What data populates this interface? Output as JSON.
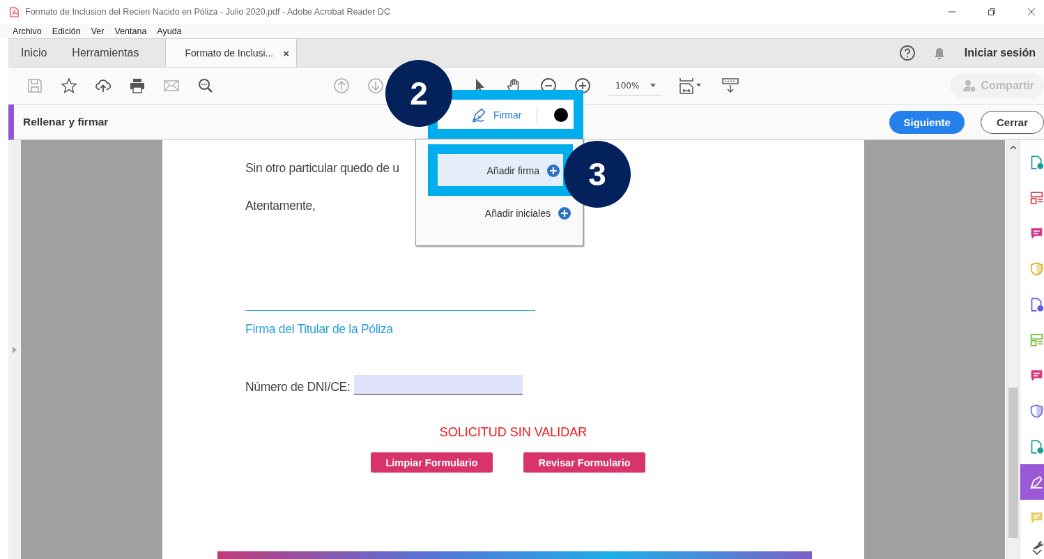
{
  "window": {
    "title": "Formato de Inclusion del Recien Nacido en Póliza - Julio 2020.pdf - Adobe Acrobat Reader DC"
  },
  "menu": [
    "Archivo",
    "Edición",
    "Ver",
    "Ventana",
    "Ayuda"
  ],
  "tabs": [
    {
      "label": "Inicio",
      "selected": false
    },
    {
      "label": "Herramientas",
      "selected": false
    },
    {
      "label": "Formato de Inclusi...",
      "selected": true,
      "close": "×"
    }
  ],
  "sign_in": "Iniciar sesión",
  "toolbar": {
    "zoom": "100%",
    "share": {
      "label": "Compartir",
      "disabled": true
    }
  },
  "fill_sign": {
    "title": "Rellenar y firmar",
    "sign": "Firmar",
    "next": "Siguiente",
    "close": "Cerrar"
  },
  "sign_menu": {
    "items": [
      {
        "label": "Añadir firma",
        "selected": true
      },
      {
        "label": "Añadir iniciales",
        "selected": false
      }
    ]
  },
  "annotations": [
    {
      "label": "2"
    },
    {
      "label": "3"
    }
  ],
  "document": {
    "line_1": "Sin otro particular quedo de u",
    "line_2": "Atentamente,",
    "signature_caption": "Firma del Titular de la Póliza",
    "dni_label": "Número de DNI/CE:",
    "status": "SOLICITUD SIN VALIDAR",
    "buttons": [
      "Limpiar Formulario",
      "Revisar Formulario"
    ]
  },
  "right_tools": [
    {
      "color": "#1a9c9c",
      "selected": false
    },
    {
      "color": "#e0424a",
      "selected": false
    },
    {
      "color": "#d6388a",
      "selected": false
    },
    {
      "color": "#d8b21c",
      "selected": false
    },
    {
      "color": "#5a5ee0",
      "selected": false
    },
    {
      "color": "#6cc02a",
      "selected": false
    },
    {
      "color": "#e0357a",
      "selected": false
    },
    {
      "color": "#6b6be8",
      "selected": false
    },
    {
      "color": "#1a9c9c",
      "selected": false
    },
    {
      "color": "#9b59d8",
      "selected": true
    },
    {
      "color": "#e6cf66",
      "selected": false
    }
  ]
}
